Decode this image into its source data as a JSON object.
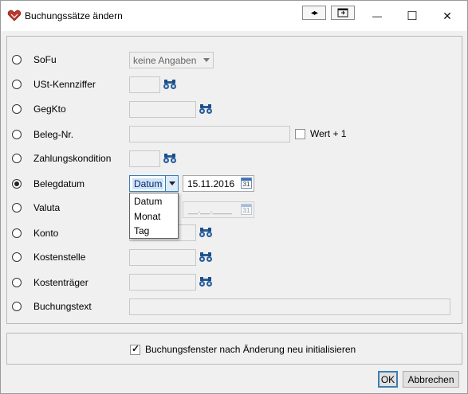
{
  "window": {
    "title": "Buchungssätze ändern",
    "controls": {
      "minimize": "—",
      "maximize": "☐",
      "close": "✕"
    },
    "toolbar": {
      "btn1_icon": "arrows-left-right-icon",
      "btn2_icon": "window-restore-icon"
    }
  },
  "rows": [
    {
      "key": "sofu",
      "label": "SoFu"
    },
    {
      "key": "ust",
      "label": "USt-Kennziffer"
    },
    {
      "key": "gegkto",
      "label": "GegKto"
    },
    {
      "key": "beleg",
      "label": "Beleg-Nr."
    },
    {
      "key": "zahlung",
      "label": "Zahlungskondition"
    },
    {
      "key": "belegdatum",
      "label": "Belegdatum"
    },
    {
      "key": "valuta",
      "label": "Valuta"
    },
    {
      "key": "konto",
      "label": "Konto"
    },
    {
      "key": "kostenstelle",
      "label": "Kostenstelle"
    },
    {
      "key": "kostentraeger",
      "label": "Kostenträger"
    },
    {
      "key": "buchungstext",
      "label": "Buchungstext"
    }
  ],
  "selected_row": "Belegdatum",
  "sofu_select": {
    "value": "keine Angaben"
  },
  "wert_checkbox": {
    "label": "Wert + 1",
    "checked": false
  },
  "belegdatum": {
    "combo_value": "Datum",
    "date_value": "15.11.2016",
    "options": [
      "Datum",
      "Monat",
      "Tag"
    ]
  },
  "valuta": {
    "date_placeholder": "__.__.____"
  },
  "calendar_icon_text": "31",
  "reinit_checkbox": {
    "label": "Buchungsfenster nach Änderung neu initialisieren",
    "checked": true
  },
  "buttons": {
    "ok": "OK",
    "cancel": "Abbrechen"
  },
  "colors": {
    "accent": "#3c7fb1",
    "selection": "#cce4f7"
  }
}
